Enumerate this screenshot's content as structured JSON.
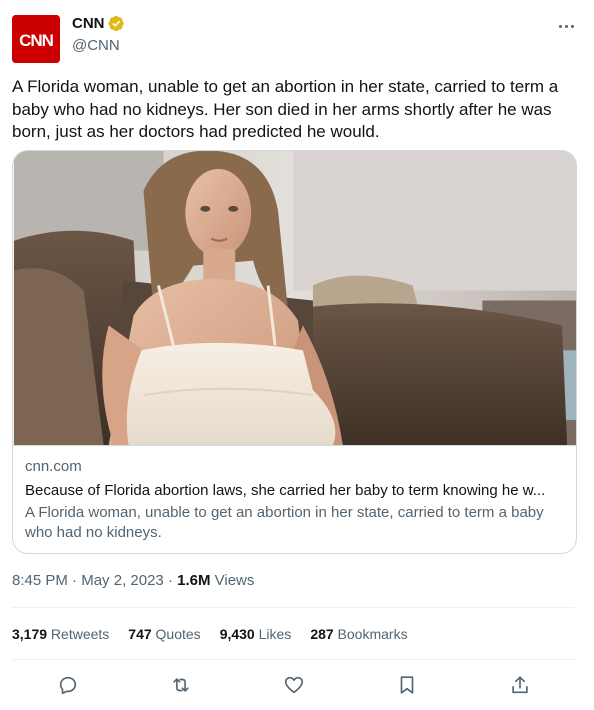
{
  "author": {
    "name": "CNN",
    "handle": "@CNN",
    "avatar_text": "CNN",
    "verified_icon": "verified-badge-gold"
  },
  "tweet": {
    "text": "A Florida woman, unable to get an abortion in her state, carried to term a baby who had no kidneys. Her son died in her arms shortly after he was born, just as her doctors had predicted he would."
  },
  "card": {
    "domain": "cnn.com",
    "title": "Because of Florida abortion laws, she carried her baby to term knowing he w...",
    "description": "A Florida woman, unable to get an abortion in her state, carried to term a baby who had no kidneys."
  },
  "meta": {
    "time": "8:45 PM",
    "sep1": " · ",
    "date": "May 2, 2023",
    "sep2": " · ",
    "views_count": "1.6M",
    "views_label": " Views"
  },
  "stats": {
    "retweets_count": "3,179",
    "retweets_label": " Retweets",
    "quotes_count": "747",
    "quotes_label": " Quotes",
    "likes_count": "9,430",
    "likes_label": " Likes",
    "bookmarks_count": "287",
    "bookmarks_label": " Bookmarks"
  },
  "actions": [
    "reply-icon",
    "retweet-icon",
    "like-icon",
    "bookmark-icon",
    "share-icon"
  ],
  "colors": {
    "brand_red": "#cc0000",
    "text_primary": "#0f1419",
    "text_secondary": "#536471",
    "border": "#cfd9de",
    "verified_gold": "#e2b719"
  }
}
